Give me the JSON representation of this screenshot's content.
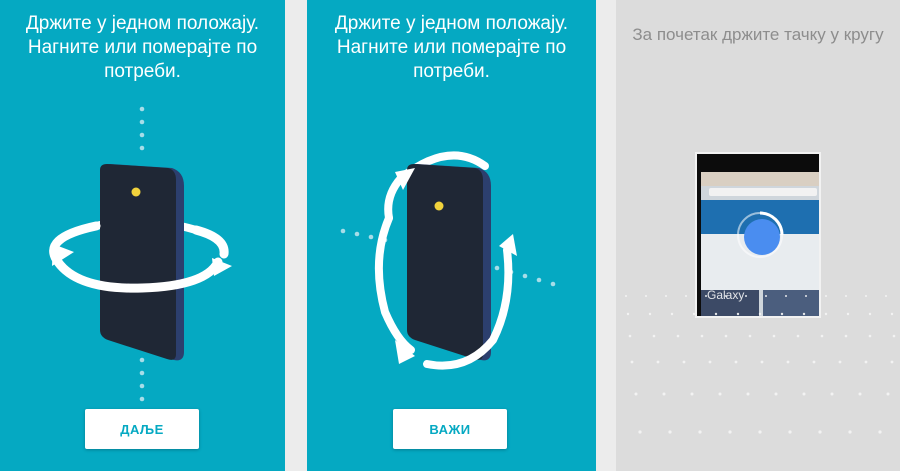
{
  "panels": [
    {
      "instruction": "Држите у једном положају.\nНагните или померајте по\nпотреби.",
      "button_label": "ДАЉЕ"
    },
    {
      "instruction": "Држите у једном положају.\nНагните или померајте по\nпотреби.",
      "button_label": "ВАЖИ"
    },
    {
      "hint": "За почетак држите тачку у кругу",
      "preview_brand": "Galaxy"
    }
  ],
  "colors": {
    "teal": "#05a9c2",
    "phone_body": "#1f2735",
    "phone_edge": "#2c3f6e",
    "camera_light": "#f1d23c",
    "target_dot": "#4a8df0",
    "panel_gray": "#dcdcdc"
  },
  "icons": [
    "phone-illustration",
    "rotate-horizontal-arrows-icon",
    "rotate-vertical-arrows-icon",
    "target-dot-icon"
  ]
}
